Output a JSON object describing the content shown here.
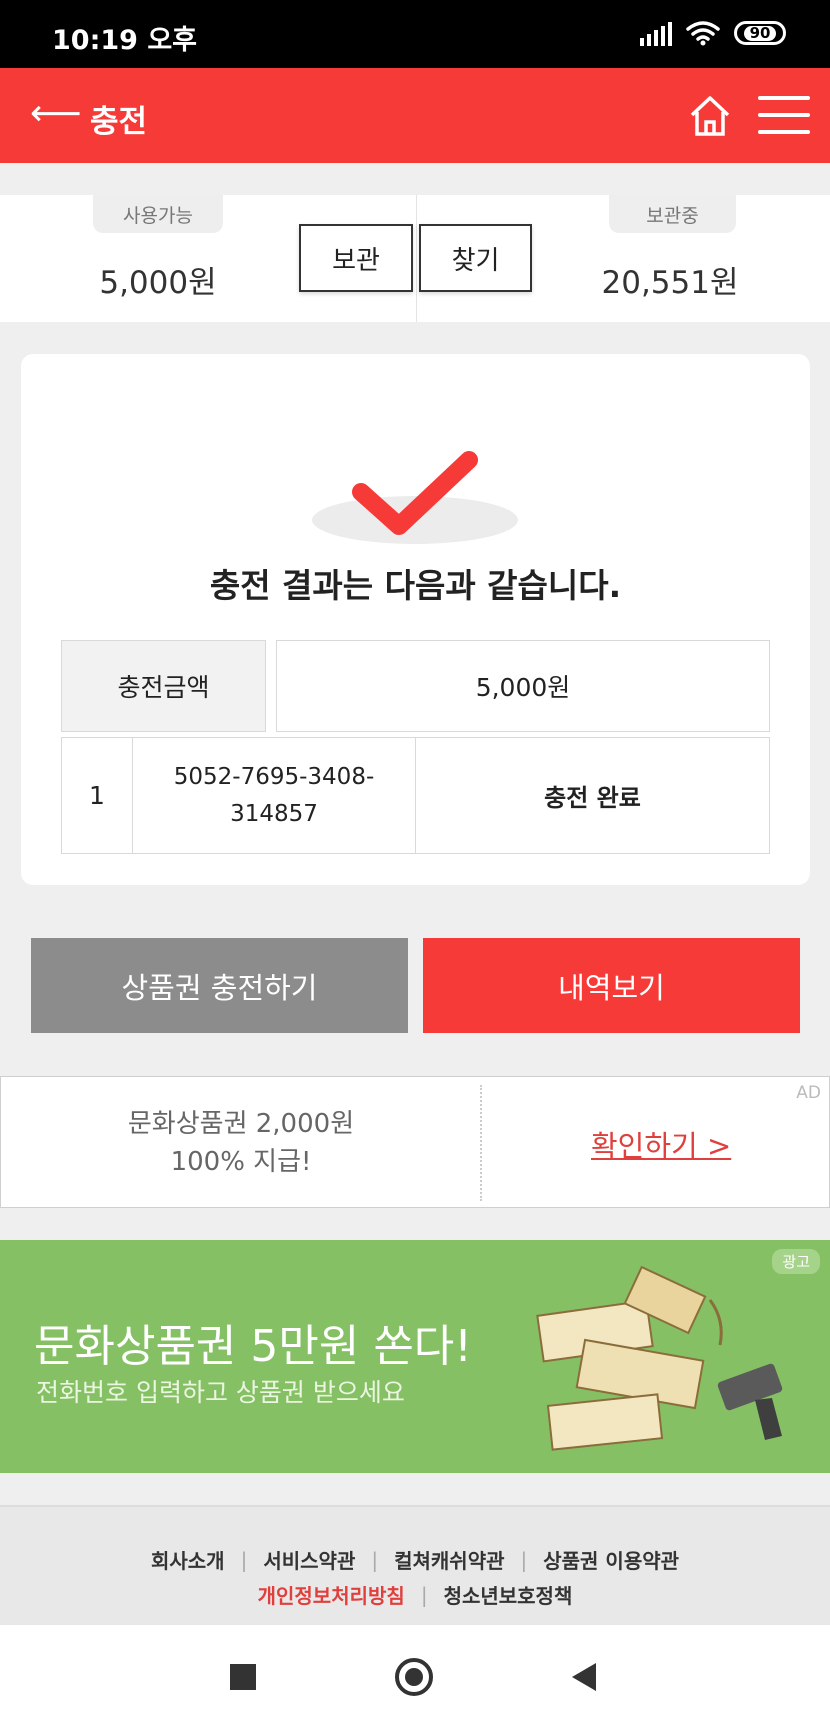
{
  "status_bar": {
    "time": "10:19 오후",
    "battery": "90"
  },
  "header": {
    "title": "충전"
  },
  "balance": {
    "available_label": "사용가능",
    "available_amount": "5,000원",
    "store_button": "보관",
    "find_button": "찾기",
    "stored_label": "보관중",
    "stored_amount": "20,551원"
  },
  "result": {
    "title": "충전 결과는 다음과 같습니다.",
    "amount_label": "충전금액",
    "amount_value": "5,000원",
    "rows": [
      {
        "index": "1",
        "pin": "5052-7695-3408-\n314857",
        "status": "충전 완료"
      }
    ]
  },
  "actions": {
    "charge_button": "상품권 충전하기",
    "history_button": "내역보기"
  },
  "ad": {
    "line1": "문화상품권 2,000원",
    "line2": "100% 지급!",
    "link": "확인하기 >",
    "tag": "AD"
  },
  "banner": {
    "headline": "문화상품권 5만원 쏜다!",
    "subtext": "전화번호 입력하고 상품권 받으세요",
    "tag": "광고"
  },
  "footer": {
    "links_row1": [
      "회사소개",
      "서비스약관",
      "컬쳐캐쉬약관",
      "상품권 이용약관"
    ],
    "links_row2": [
      "개인정보처리방침",
      "청소년보호정책"
    ]
  },
  "colors": {
    "accent": "#f63a38",
    "gray_button": "#8c8c8c",
    "banner_green": "#86c064"
  }
}
